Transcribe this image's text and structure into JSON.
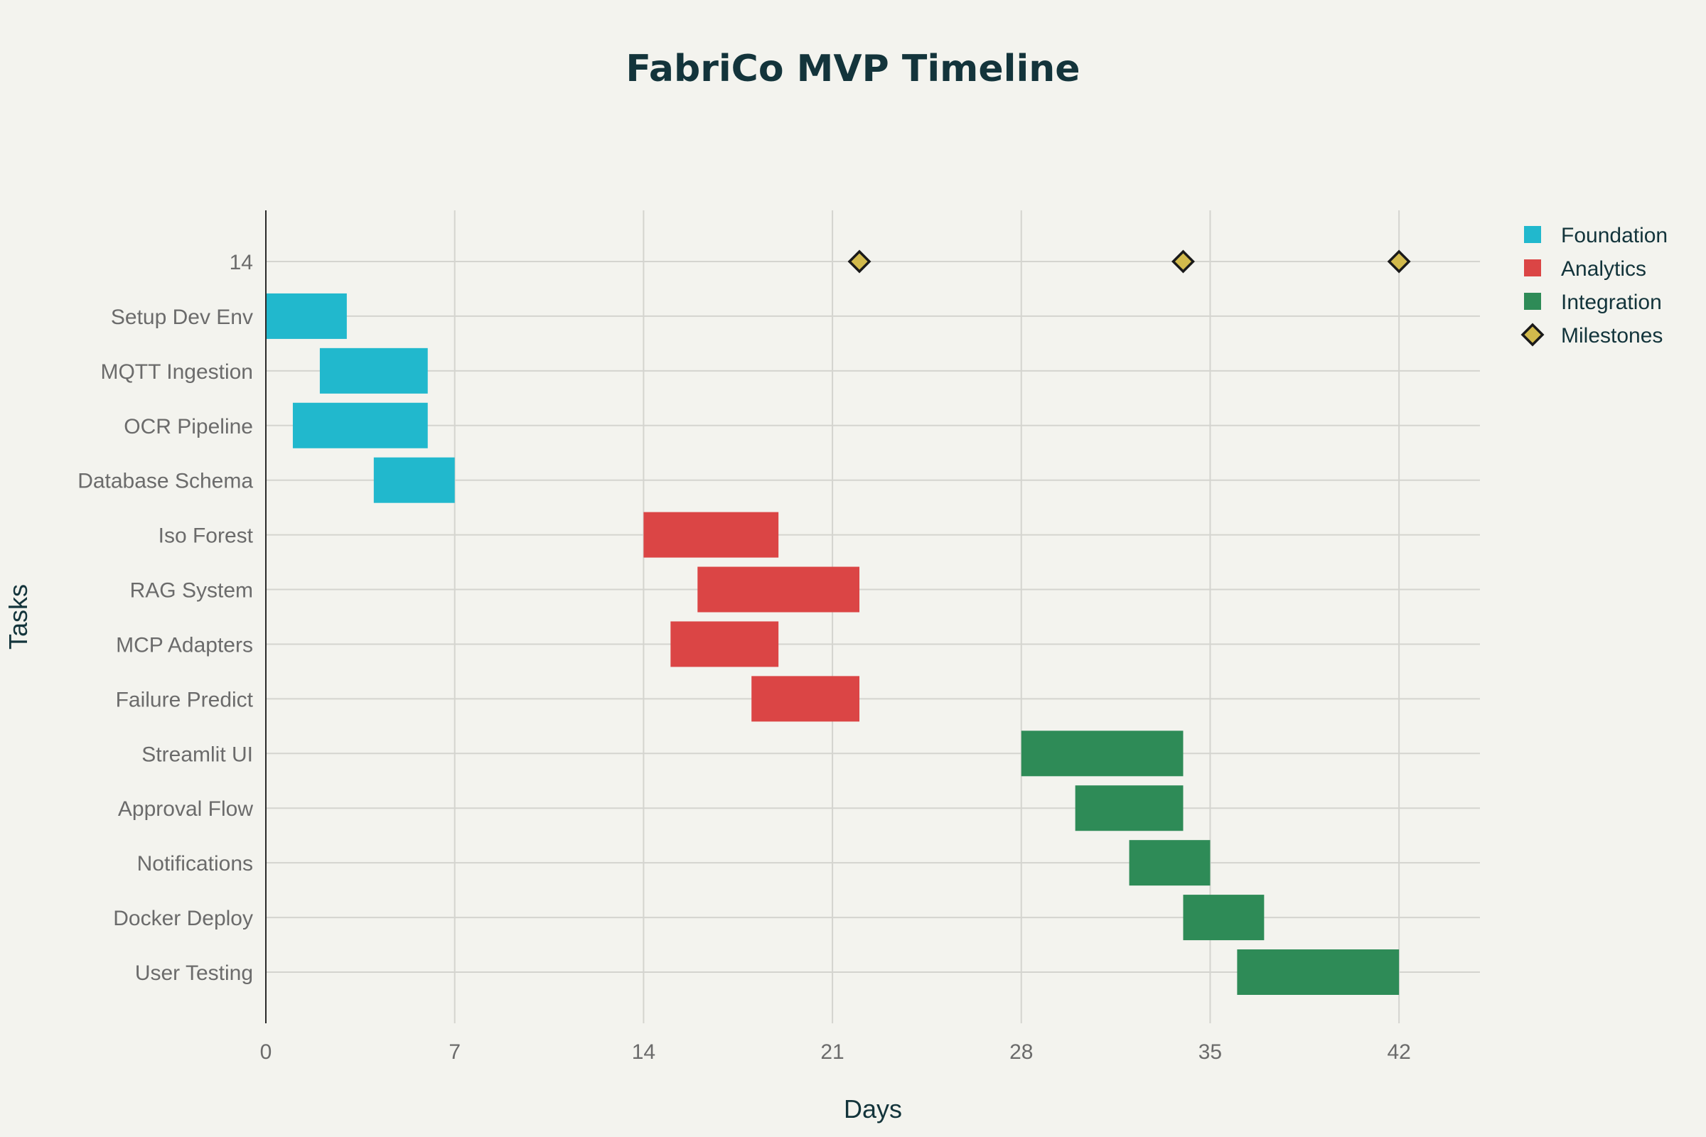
{
  "chart_data": {
    "type": "gantt",
    "title": "FabriCo MVP Timeline",
    "xlabel": "Days",
    "ylabel": "Tasks",
    "xlim": [
      0,
      45
    ],
    "x_ticks": [
      0,
      7,
      14,
      21,
      28,
      35,
      42
    ],
    "grid": true,
    "legend_position": "top-right",
    "categories": [
      "14",
      "Setup Dev Env",
      "MQTT Ingestion",
      "OCR Pipeline",
      "Database Schema",
      "Iso Forest",
      "RAG System",
      "MCP Adapters",
      "Failure Predict",
      "Streamlit UI",
      "Approval Flow",
      "Notifications",
      "Docker Deploy",
      "User Testing"
    ],
    "series": [
      {
        "name": "Foundation",
        "color": "#21b8cd",
        "tasks": [
          {
            "task": "Setup Dev Env",
            "start": 0,
            "end": 3
          },
          {
            "task": "MQTT Ingestion",
            "start": 2,
            "end": 6
          },
          {
            "task": "OCR Pipeline",
            "start": 1,
            "end": 6
          },
          {
            "task": "Database Schema",
            "start": 4,
            "end": 7
          }
        ]
      },
      {
        "name": "Analytics",
        "color": "#db4545",
        "tasks": [
          {
            "task": "Iso Forest",
            "start": 14,
            "end": 19
          },
          {
            "task": "RAG System",
            "start": 16,
            "end": 22
          },
          {
            "task": "MCP Adapters",
            "start": 15,
            "end": 19
          },
          {
            "task": "Failure Predict",
            "start": 18,
            "end": 22
          }
        ]
      },
      {
        "name": "Integration",
        "color": "#2e8b57",
        "tasks": [
          {
            "task": "Streamlit UI",
            "start": 28,
            "end": 34
          },
          {
            "task": "Approval Flow",
            "start": 30,
            "end": 34
          },
          {
            "task": "Notifications",
            "start": 32,
            "end": 35
          },
          {
            "task": "Docker Deploy",
            "start": 34,
            "end": 37
          },
          {
            "task": "User Testing",
            "start": 36,
            "end": 42
          }
        ]
      }
    ],
    "milestones": {
      "name": "Milestones",
      "color": "#d2ba4c",
      "row": "14",
      "days": [
        22,
        34,
        42
      ]
    }
  }
}
